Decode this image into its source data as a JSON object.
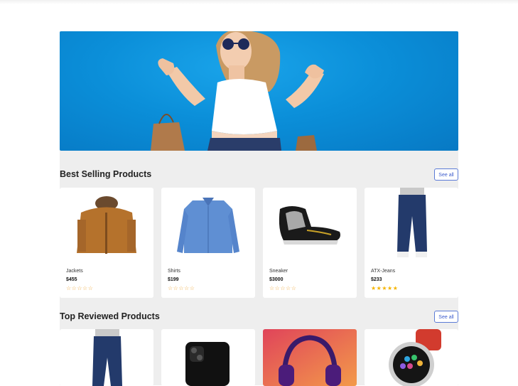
{
  "best_selling": {
    "title": "Best Selling Products",
    "see_all": "See all",
    "products": [
      {
        "name": "Jackets",
        "price": "$455",
        "rating": 0,
        "rating_stars": "☆☆☆☆☆",
        "icon": "jacket-image"
      },
      {
        "name": "Shirts",
        "price": "$199",
        "rating": 0,
        "rating_stars": "☆☆☆☆☆",
        "icon": "shirt-image"
      },
      {
        "name": "Sneaker",
        "price": "$3000",
        "rating": 0,
        "rating_stars": "☆☆☆☆☆",
        "icon": "sneaker-image"
      },
      {
        "name": "ATX-Jeans",
        "price": "$233",
        "rating": 5,
        "rating_stars": "★★★★★",
        "icon": "jeans-image"
      }
    ]
  },
  "top_reviewed": {
    "title": "Top Reviewed Products",
    "see_all": "See all",
    "products": [
      {
        "icon": "jeans-image"
      },
      {
        "icon": "smartphone-image"
      },
      {
        "icon": "headphones-image"
      },
      {
        "icon": "smartwatch-image"
      }
    ]
  },
  "colors": {
    "accent": "#3b5bcc",
    "hero_background": "#0b8fd9",
    "page_background": "#eeeeee",
    "star": "#f5b400"
  }
}
